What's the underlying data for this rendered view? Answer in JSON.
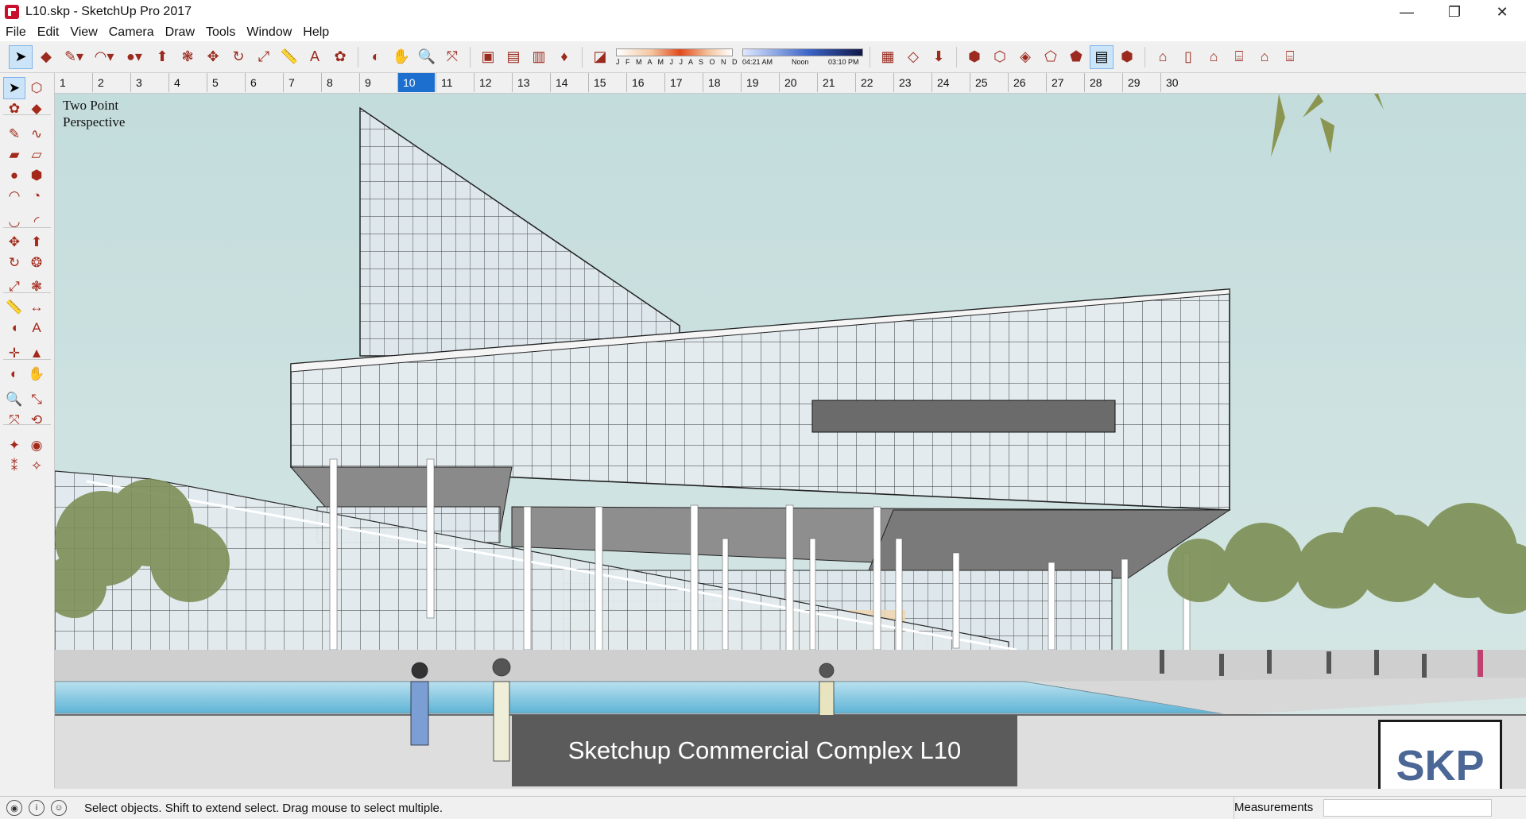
{
  "window": {
    "title": "L10.skp - SketchUp Pro 2017",
    "min": "—",
    "restore": "❐",
    "close": "✕"
  },
  "menu": [
    "File",
    "Edit",
    "View",
    "Camera",
    "Draw",
    "Tools",
    "Window",
    "Help"
  ],
  "shadow_settings": {
    "months": "J F M A M J J A S O N D",
    "time_start": "04:21 AM",
    "time_mid": "Noon",
    "time_end": "03:10 PM"
  },
  "scenes": [
    "1",
    "2",
    "3",
    "4",
    "5",
    "6",
    "7",
    "8",
    "9",
    "10",
    "11",
    "12",
    "13",
    "14",
    "15",
    "16",
    "17",
    "18",
    "19",
    "20",
    "21",
    "22",
    "23",
    "24",
    "25",
    "26",
    "27",
    "28",
    "29",
    "30"
  ],
  "active_scene": "10",
  "viewport": {
    "camera_label": "Two Point\nPerspective",
    "caption": "Sketchup Commercial Complex L10",
    "logo_text": "SKP"
  },
  "statusbar": {
    "text": "Select objects. Shift to extend select. Drag mouse to select multiple.",
    "measurements_label": "Measurements",
    "measurements_value": ""
  },
  "colors": {
    "active_tab": "#1c6fcf",
    "selected_tool": "#cce4f7",
    "sky": "#c6dede",
    "glass": "#dbe6ec",
    "water": "#9fd0e8"
  }
}
